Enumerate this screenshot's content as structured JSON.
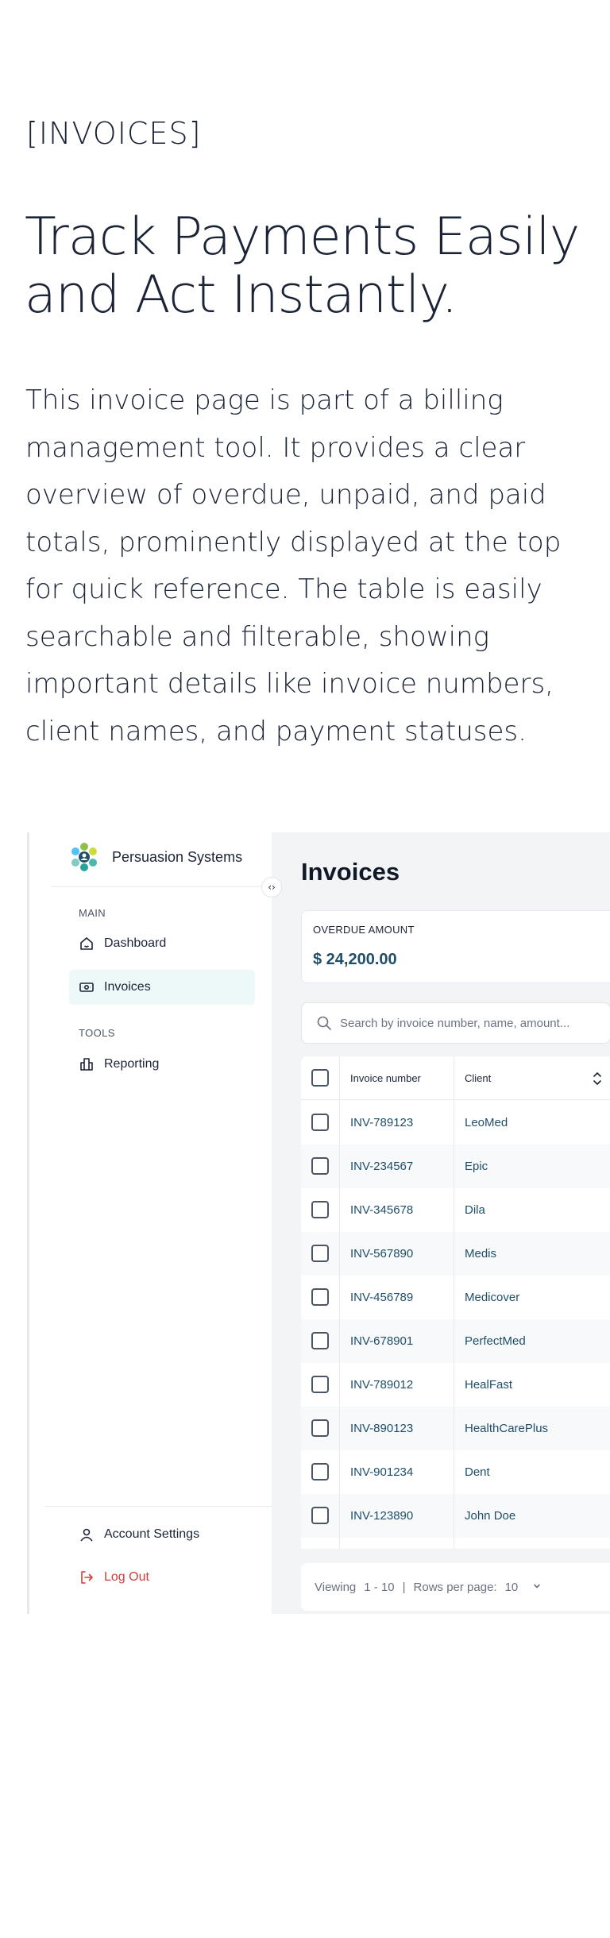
{
  "intro": {
    "eyebrow": "[INVOICES]",
    "headline": "Track Payments Easily and Act Instantly.",
    "description": "This invoice page is part of a billing management tool. It provides a clear overview of overdue, unpaid, and paid totals, prominently displayed at the top for quick reference. The table is easily searchable and filterable, showing important details like invoice numbers, client names, and payment statuses."
  },
  "sidebar": {
    "brand": "Persuasion Systems",
    "main_label": "MAIN",
    "tools_label": "TOOLS",
    "items": [
      {
        "label": "Dashboard",
        "icon": "home-icon"
      },
      {
        "label": "Invoices",
        "icon": "bill-icon",
        "active": true
      },
      {
        "label": "Reporting",
        "icon": "building-icon"
      }
    ],
    "account_settings": "Account Settings",
    "logout": "Log Out"
  },
  "main": {
    "title": "Invoices",
    "overdue_label": "OVERDUE AMOUNT",
    "overdue_value": "$ 24,200.00",
    "search_placeholder": "Search by invoice number, name, amount...",
    "columns": [
      "Invoice number",
      "Client"
    ],
    "rows": [
      {
        "invoice": "INV-789123",
        "client": "LeoMed"
      },
      {
        "invoice": "INV-234567",
        "client": "Epic"
      },
      {
        "invoice": "INV-345678",
        "client": "Dila"
      },
      {
        "invoice": "INV-567890",
        "client": "Medis"
      },
      {
        "invoice": "INV-456789",
        "client": "Medicover"
      },
      {
        "invoice": "INV-678901",
        "client": "PerfectMed"
      },
      {
        "invoice": "INV-789012",
        "client": "HealFast"
      },
      {
        "invoice": "INV-890123",
        "client": "HealthCarePlus"
      },
      {
        "invoice": "INV-901234",
        "client": "Dent"
      },
      {
        "invoice": "INV-123890",
        "client": "John Doe"
      }
    ],
    "pager": {
      "viewing_label": "Viewing",
      "range": "1 - 10",
      "separator": "|",
      "rows_label": "Rows per page:",
      "rows_value": "10"
    }
  },
  "colors": {
    "link": "#1f4e6a",
    "active_bg": "#edf9f8",
    "danger": "#d23c3c",
    "ink": "#1b2437"
  }
}
